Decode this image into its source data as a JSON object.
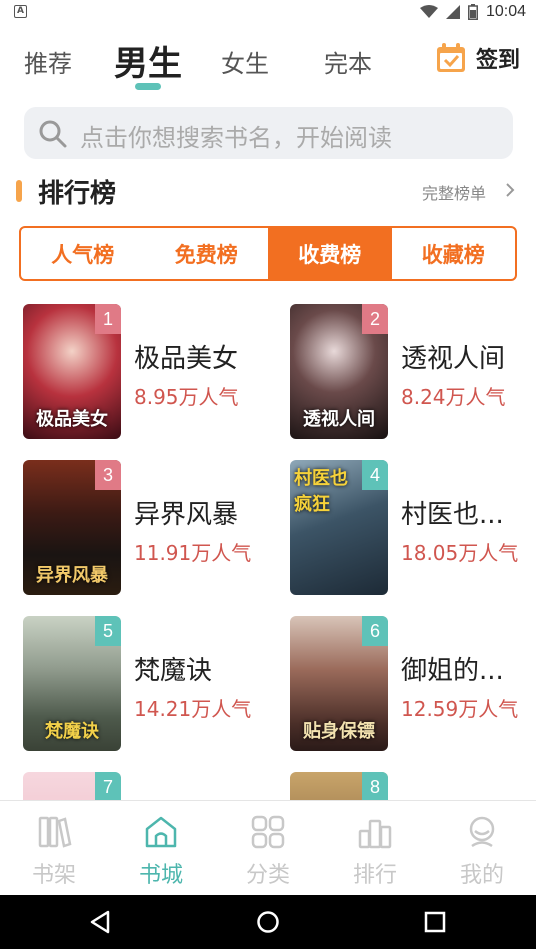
{
  "status_bar": {
    "time": "10:04",
    "app_icon_letter": "A"
  },
  "top_tabs": [
    {
      "label": "推荐",
      "active": false
    },
    {
      "label": "男生",
      "active": true
    },
    {
      "label": "女生",
      "active": false
    },
    {
      "label": "完本",
      "active": false
    }
  ],
  "checkin": {
    "label": "签到"
  },
  "search": {
    "placeholder": "点击你想搜索书名，开始阅读"
  },
  "ranking": {
    "title": "排行榜",
    "more": "完整榜单",
    "segments": [
      {
        "label": "人气榜",
        "active": false
      },
      {
        "label": "免费榜",
        "active": false
      },
      {
        "label": "收费榜",
        "active": true
      },
      {
        "label": "收藏榜",
        "active": false
      }
    ]
  },
  "books": [
    {
      "rank": "1",
      "name": "极品美女",
      "popularity": "8.95万人气",
      "cover_text": "极品美女",
      "badge_color": "#e07a86"
    },
    {
      "rank": "2",
      "name": "透视人间",
      "popularity": "8.24万人气",
      "cover_text": "透视人间",
      "badge_color": "#e07a86"
    },
    {
      "rank": "3",
      "name": "异界风暴",
      "popularity": "11.91万人气",
      "cover_text": "异界风暴",
      "badge_color": "#e07a86"
    },
    {
      "rank": "4",
      "name": "村医也...",
      "popularity": "18.05万人气",
      "cover_text": "村医也疯狂",
      "badge_color": "#5ec2b8"
    },
    {
      "rank": "5",
      "name": "梵魔诀",
      "popularity": "14.21万人气",
      "cover_text": "梵魔诀",
      "badge_color": "#5ec2b8"
    },
    {
      "rank": "6",
      "name": "御姐的...",
      "popularity": "12.59万人气",
      "cover_text": "贴身保镖",
      "badge_color": "#5ec2b8"
    },
    {
      "rank": "7",
      "name": "",
      "popularity": "",
      "cover_text": "",
      "badge_color": "#5ec2b8"
    },
    {
      "rank": "8",
      "name": "",
      "popularity": "",
      "cover_text": "",
      "badge_color": "#5ec2b8"
    }
  ],
  "bottom_nav": [
    {
      "label": "书架",
      "icon": "bookshelf-icon",
      "active": false
    },
    {
      "label": "书城",
      "icon": "bookstore-icon",
      "active": true
    },
    {
      "label": "分类",
      "icon": "category-icon",
      "active": false
    },
    {
      "label": "排行",
      "icon": "ranking-icon",
      "active": false
    },
    {
      "label": "我的",
      "icon": "profile-icon",
      "active": false
    }
  ],
  "colors": {
    "accent_orange": "#f26f21",
    "accent_teal": "#4db6ad",
    "popularity_red": "#d0564f"
  }
}
